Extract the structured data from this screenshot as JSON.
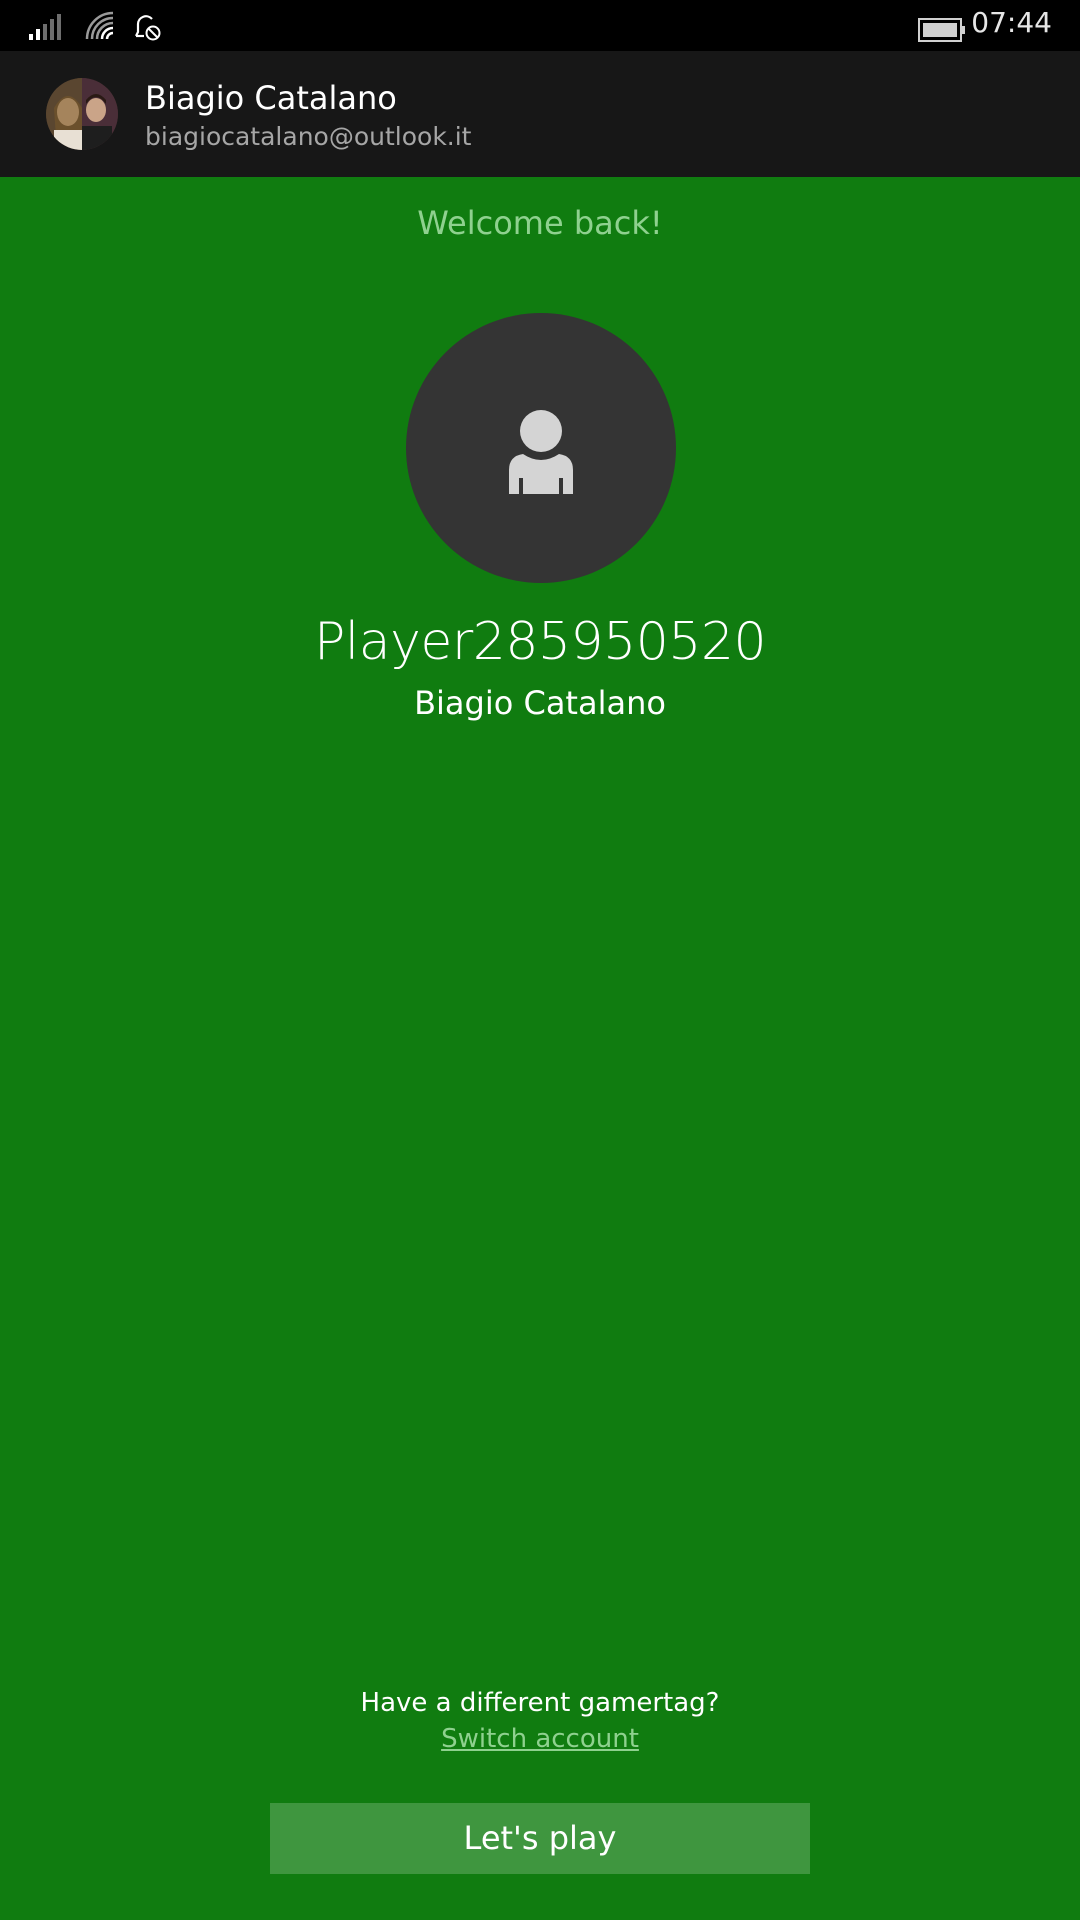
{
  "status_bar": {
    "time": "07:44",
    "icons": [
      "signal-icon",
      "wifi-icon",
      "notification-off-icon",
      "battery-icon"
    ]
  },
  "account": {
    "name": "Biagio Catalano",
    "email": "biagiocatalano@outlook.it"
  },
  "main": {
    "welcome": "Welcome back!",
    "gamertag": "Player285950520",
    "real_name": "Biagio Catalano",
    "different_prompt": "Have a different gamertag?",
    "switch_account": "Switch account",
    "play_button": "Let's play"
  },
  "colors": {
    "background": "#107c10",
    "header": "#171717",
    "accent_light": "#8fd18f",
    "button": "#3f963f",
    "avatar_circle": "#343434"
  }
}
